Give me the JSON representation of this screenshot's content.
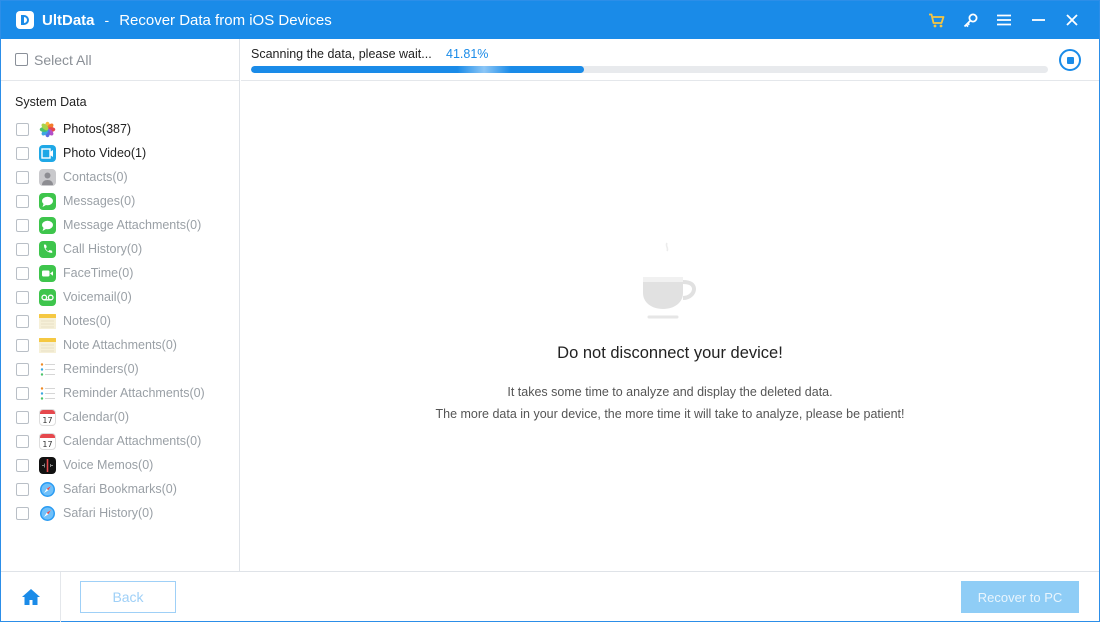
{
  "app": {
    "brand": "UltData",
    "separator": "-",
    "subtitle": "Recover Data from iOS Devices",
    "accent": "#1a8be8"
  },
  "titlebar": {
    "icons": [
      "cart-icon",
      "key-icon",
      "menu-icon",
      "minimize-icon",
      "close-icon"
    ]
  },
  "sidebar": {
    "select_all_label": "Select All",
    "group_title": "System Data",
    "items": [
      {
        "label": "Photos(387)",
        "icon": "photos-icon",
        "active": true
      },
      {
        "label": "Photo Video(1)",
        "icon": "photo-video-icon",
        "active": true
      },
      {
        "label": "Contacts(0)",
        "icon": "contacts-icon",
        "active": false
      },
      {
        "label": "Messages(0)",
        "icon": "messages-icon",
        "active": false
      },
      {
        "label": "Message Attachments(0)",
        "icon": "message-attachments-icon",
        "active": false
      },
      {
        "label": "Call History(0)",
        "icon": "phone-icon",
        "active": false
      },
      {
        "label": "FaceTime(0)",
        "icon": "facetime-icon",
        "active": false
      },
      {
        "label": "Voicemail(0)",
        "icon": "voicemail-icon",
        "active": false
      },
      {
        "label": "Notes(0)",
        "icon": "notes-icon",
        "active": false
      },
      {
        "label": "Note Attachments(0)",
        "icon": "note-attachments-icon",
        "active": false
      },
      {
        "label": "Reminders(0)",
        "icon": "reminders-icon",
        "active": false
      },
      {
        "label": "Reminder Attachments(0)",
        "icon": "reminder-attachments-icon",
        "active": false
      },
      {
        "label": "Calendar(0)",
        "icon": "calendar-icon",
        "active": false
      },
      {
        "label": "Calendar Attachments(0)",
        "icon": "calendar-attachments-icon",
        "active": false
      },
      {
        "label": "Voice Memos(0)",
        "icon": "voice-memos-icon",
        "active": false
      },
      {
        "label": "Safari Bookmarks(0)",
        "icon": "safari-icon",
        "active": false
      },
      {
        "label": "Safari History(0)",
        "icon": "safari-icon",
        "active": false
      }
    ]
  },
  "scan": {
    "status": "Scanning the data, please wait...",
    "percent_text": "41.81%",
    "progress": 0.4181
  },
  "message": {
    "headline": "Do not disconnect your device!",
    "line1": "It takes some time to analyze and display the deleted data.",
    "line2": "The more data in your device, the more time it will take to analyze, please be patient!"
  },
  "footer": {
    "back_label": "Back",
    "recover_label": "Recover to PC"
  }
}
